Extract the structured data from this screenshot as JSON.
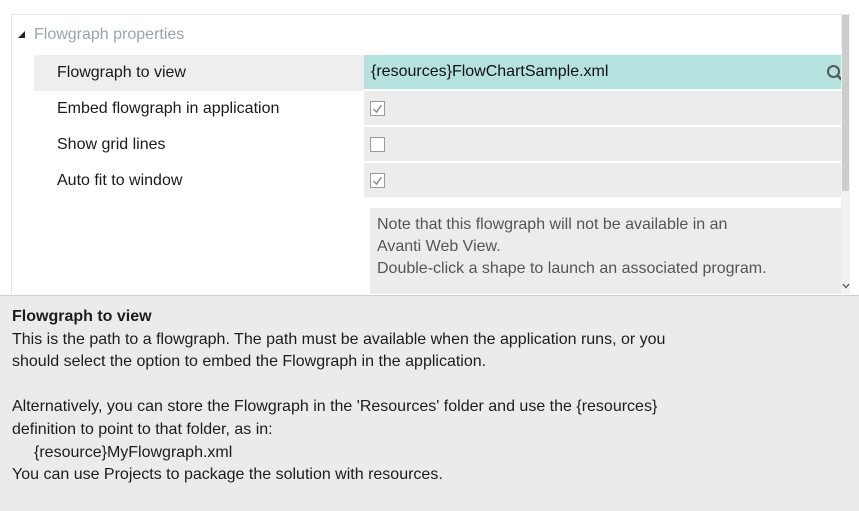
{
  "section": {
    "title": "Flowgraph properties"
  },
  "properties": {
    "flowgraph_label": "Flowgraph to view",
    "flowgraph_value": "{resources}FlowChartSample.xml",
    "embed_label": "Embed flowgraph in application",
    "embed_checked": true,
    "grid_label": "Show grid lines",
    "grid_checked": false,
    "autofit_label": "Auto fit to window",
    "autofit_checked": true,
    "note_line1": "Note that this flowgraph will not be available in an",
    "note_line2": "Avanti Web View.",
    "note_line3": "Double-click a shape to launch an associated program."
  },
  "description": {
    "heading": "Flowgraph to view",
    "line1": "This is the path to a flowgraph. The path must be available when the application runs, or you",
    "line2": "should select the option to embed the Flowgraph in the application.",
    "line3": "Alternatively, you can store the Flowgraph in the 'Resources' folder and use the {resources}",
    "line4": "definition to point to that folder, as in:",
    "line5": "{resource}MyFlowgraph.xml",
    "line6": "You can use Projects to package the solution with resources."
  },
  "icons": {
    "section_toggle": "caret-down-icon",
    "search": "search-icon",
    "check": "check-icon",
    "scroll_down": "chevron-down-icon"
  },
  "colors": {
    "selected_value_bg": "#b5e1de",
    "value_bg": "#ececec",
    "description_bg": "#ebebeb",
    "section_title": "#9aa3ad"
  }
}
